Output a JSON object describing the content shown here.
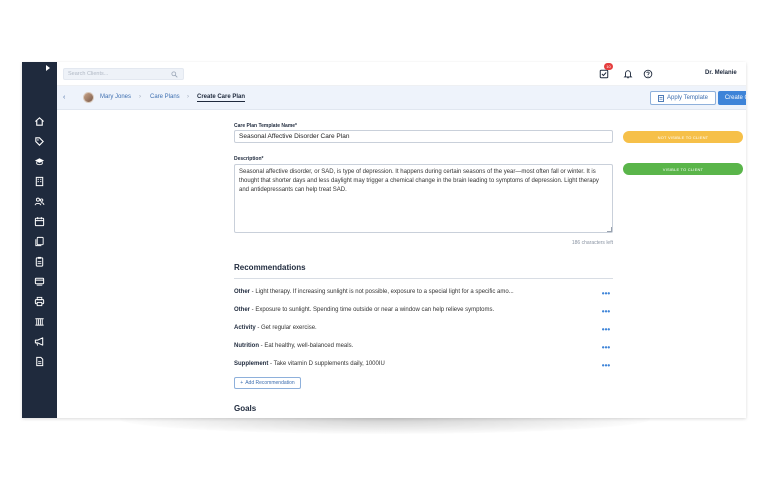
{
  "search": {
    "placeholder": "Search Clients..."
  },
  "topbar": {
    "notification_count": "10",
    "user_name": "Dr. Melanie"
  },
  "breadcrumb": {
    "client": "Mary Jones",
    "section": "Care Plans",
    "current": "Create Care Plan"
  },
  "actions": {
    "apply_template": "Apply Template",
    "create": "Create Care Plan"
  },
  "form": {
    "name_label": "Care Plan Template Name*",
    "name_value": "Seasonal Affective Disorder Care Plan",
    "description_label": "Description*",
    "description_value": "Seasonal affective disorder, or SAD, is type of depression. It happens during certain seasons of the year—most often fall or winter. It is thought that shorter days and less daylight may trigger a chemical change in the brain leading to symptoms of depression. Light therapy and antidepressants can help treat SAD.",
    "chars_left": "186 characters left"
  },
  "visibility": {
    "not_visible": "NOT VISIBLE TO CLIENT",
    "visible": "VISIBLE TO CLIENT"
  },
  "recommendations": {
    "title": "Recommendations",
    "items": [
      {
        "type": "Other",
        "text": " - Light therapy.  If increasing sunlight is not possible, exposure to a special light for a specific amo..."
      },
      {
        "type": "Other",
        "text": " - Exposure to sunlight.  Spending time outside or near a window can help relieve symptoms."
      },
      {
        "type": "Activity",
        "text": " - Get regular exercise."
      },
      {
        "type": "Nutrition",
        "text": " - Eat healthy, well-balanced meals."
      },
      {
        "type": "Supplement",
        "text": " - Take vitamin D supplements daily, 1000IU"
      }
    ],
    "menu_glyph": "•••",
    "add_label": "Add Recommendation"
  },
  "goals": {
    "title": "Goals"
  },
  "colors": {
    "sidebar": "#1f2a3d",
    "accent": "#3e84d8",
    "orange": "#f6c049",
    "green": "#5ab54a"
  }
}
